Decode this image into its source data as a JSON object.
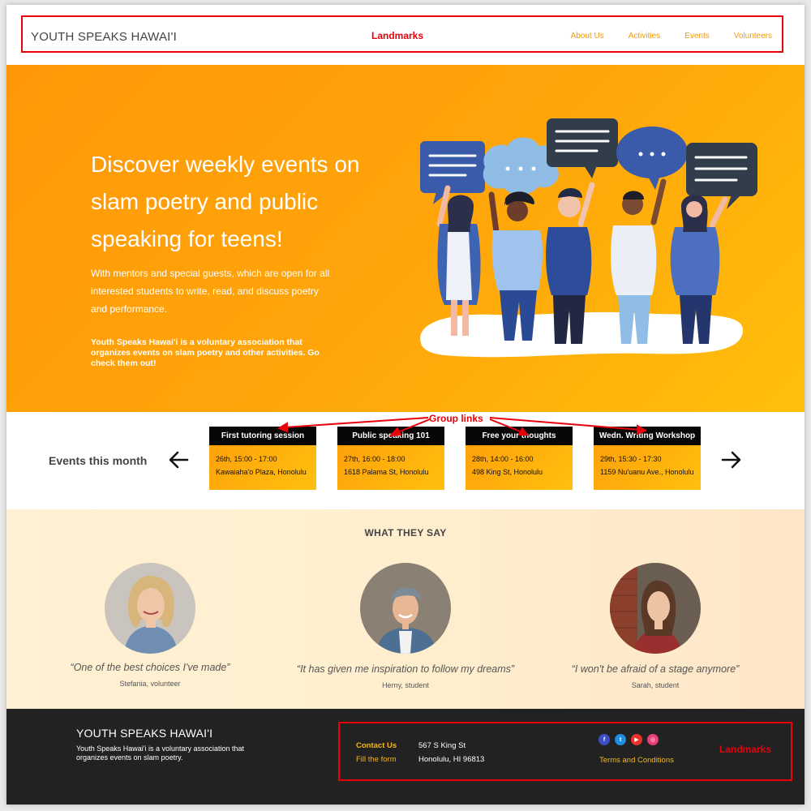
{
  "header": {
    "brand": "YOUTH SPEAKS HAWAI'I",
    "nav": [
      {
        "label": "About Us"
      },
      {
        "label": "Activities"
      },
      {
        "label": "Events"
      },
      {
        "label": "Volunteers"
      }
    ]
  },
  "annotations": {
    "header_label": "Landmarks",
    "group_links_label": "Group links",
    "footer_label": "Landmarks"
  },
  "hero": {
    "headline": "Discover weekly events on slam poetry and public speaking for teens!",
    "lead": "With mentors and special guests, which are open for all interested students to write, read, and discuss poetry and performance.",
    "about": "Youth Speaks Hawai'i is a voluntary association that organizes events on slam poetry and other activities. Go check them out!"
  },
  "events": {
    "title": "Events this month",
    "items": [
      {
        "name": "First tutoring session",
        "datetime": "26th, 15:00 - 17:00",
        "place": "Kawaiaha'o Plaza, Honolulu"
      },
      {
        "name": "Public speaking 101",
        "datetime": "27th, 16:00 - 18:00",
        "place": "1618 Palama St, Honolulu"
      },
      {
        "name": "Free your thoughts",
        "datetime": "28th, 14:00 - 16:00",
        "place": "498 King St, Honolulu"
      },
      {
        "name": "Wedn. Writing Workshop",
        "datetime": "29th, 15:30 - 17:30",
        "place": "1159 Nu'uanu Ave., Honolulu"
      }
    ]
  },
  "testimonials": {
    "title": "WHAT THEY SAY",
    "items": [
      {
        "quote": "“One of the best choices I've made”",
        "author": "Stefania, volunteer"
      },
      {
        "quote": "“It has given me inspiration to follow my dreams”",
        "author": "Herny, student"
      },
      {
        "quote": "“I won't be afraid of a stage anymore”",
        "author": "Sarah, student"
      }
    ]
  },
  "footer": {
    "brand": "YOUTH SPEAKS HAWAI'I",
    "description": "Youth Speaks Hawai'i is a voluntary association that organizes events on slam poetry.",
    "contact_label": "Contact Us",
    "fill_form_label": "Fill the form",
    "address_line1": "567 S King St",
    "address_line2": "Honolulu, HI 96813",
    "social": [
      {
        "icon": "facebook-icon",
        "glyph": "f",
        "color": "#3b4fc4"
      },
      {
        "icon": "twitter-icon",
        "glyph": "t",
        "color": "#1e8ee0"
      },
      {
        "icon": "youtube-icon",
        "glyph": "▶",
        "color": "#e8322b"
      },
      {
        "icon": "dribbble-icon",
        "glyph": "◎",
        "color": "#e83e7a"
      }
    ],
    "terms_label": "Terms and Conditions"
  },
  "colors": {
    "accent": "#f39a0e",
    "hero_start": "#ff9807",
    "hero_end": "#ffbf0c",
    "annotation": "#e8000b",
    "footer_bg": "#222222"
  }
}
